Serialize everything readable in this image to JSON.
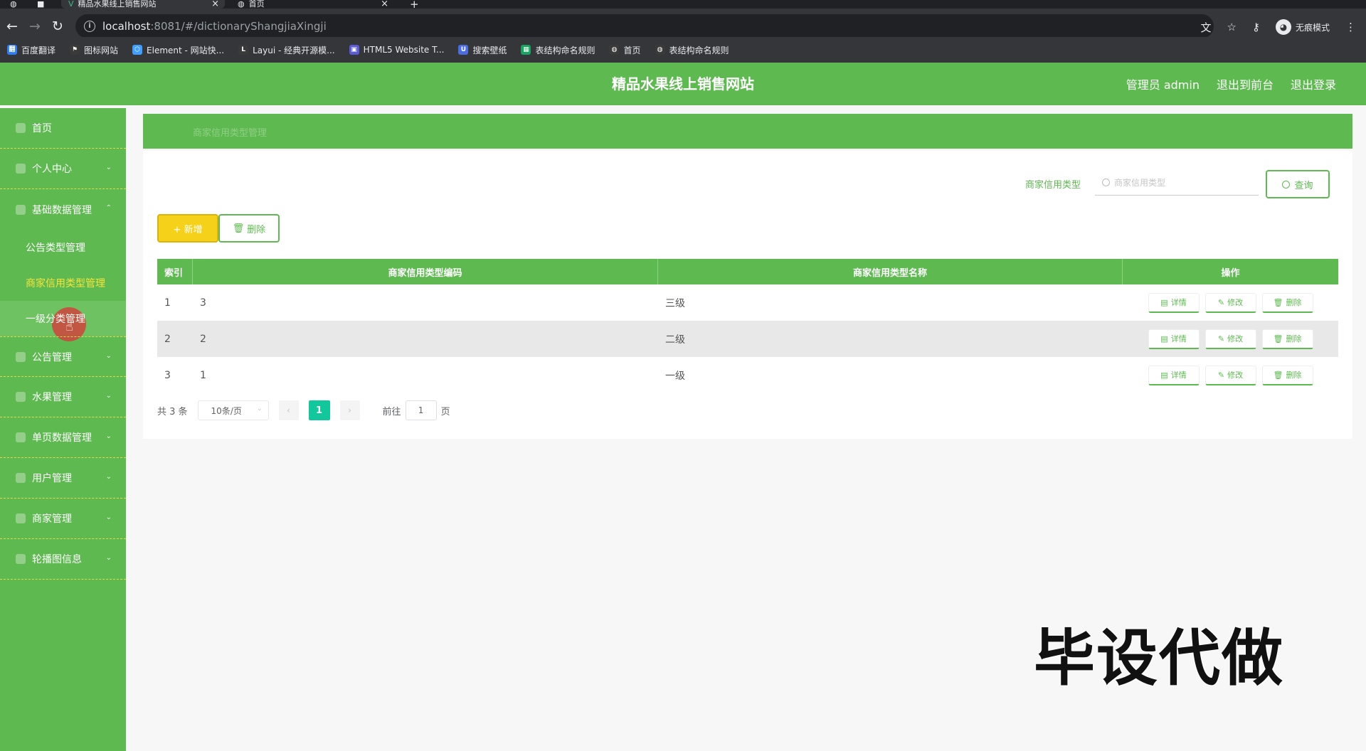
{
  "browser": {
    "tabs": [
      {
        "title": "精品水果线上销售网站"
      },
      {
        "title": "首页"
      }
    ],
    "url_host": "localhost",
    "url_rest": ":8081/#/dictionaryShangjiaXingji",
    "profile_label": "无痕模式",
    "bookmarks": [
      {
        "label": "百度翻译",
        "color": "#2f7cf6",
        "icon": "翻"
      },
      {
        "label": "图标网站",
        "color": "#3a3a3a",
        "icon": "⚑"
      },
      {
        "label": "Element - 网站快...",
        "color": "#409eff",
        "icon": "⬡"
      },
      {
        "label": "Layui - 经典开源模...",
        "color": "#3a3a3a",
        "icon": "L"
      },
      {
        "label": "HTML5 Website T...",
        "color": "#5b5bd6",
        "icon": "▣"
      },
      {
        "label": "搜索壁纸",
        "color": "#4b6de0",
        "icon": "U"
      },
      {
        "label": "表结构命名规则",
        "color": "#1aa260",
        "icon": "▦"
      },
      {
        "label": "首页",
        "color": "#3a3a3a",
        "icon": "◍"
      },
      {
        "label": "表结构命名规则",
        "color": "#3a3a3a",
        "icon": "◍"
      }
    ]
  },
  "header": {
    "title": "精品水果线上销售网站",
    "admin_label": "管理员 admin",
    "front_label": "退出到前台",
    "logout_label": "退出登录"
  },
  "sidebar": {
    "items": [
      {
        "label": "首页",
        "has_chevron": false
      },
      {
        "label": "个人中心",
        "has_chevron": true,
        "chevron": "⌄"
      },
      {
        "label": "基础数据管理",
        "has_chevron": true,
        "chevron": "⌃"
      }
    ],
    "sub_items": [
      {
        "label": "公告类型管理"
      },
      {
        "label": "商家信用类型管理"
      },
      {
        "label": "一级分类管理"
      }
    ],
    "items_after": [
      {
        "label": "公告管理"
      },
      {
        "label": "水果管理"
      },
      {
        "label": "单页数据管理"
      },
      {
        "label": "用户管理"
      },
      {
        "label": "商家管理"
      },
      {
        "label": "轮播图信息"
      }
    ]
  },
  "breadcrumb": "商家信用类型管理",
  "search": {
    "label": "商家信用类型",
    "placeholder": "商家信用类型",
    "query_label": "查询"
  },
  "actions": {
    "add_label": "+ 新增",
    "delete_label": "删除"
  },
  "table": {
    "columns": [
      "索引",
      "商家信用类型编码",
      "商家信用类型名称",
      "操作"
    ],
    "rows": [
      {
        "index": "1",
        "code": "3",
        "name": "三级"
      },
      {
        "index": "2",
        "code": "2",
        "name": "二级"
      },
      {
        "index": "3",
        "code": "1",
        "name": "一级"
      }
    ],
    "op_labels": {
      "detail": "详情",
      "edit": "修改",
      "delete": "删除"
    }
  },
  "pagination": {
    "total_label": "共 3 条",
    "page_size": "10条/页",
    "current_page": "1",
    "goto_label": "前往",
    "goto_value": "1",
    "page_unit": "页"
  },
  "watermark": "毕设代做",
  "colors": {
    "primary": "#5eb950",
    "accent": "#f5e43b",
    "pager": "#13c79c"
  }
}
